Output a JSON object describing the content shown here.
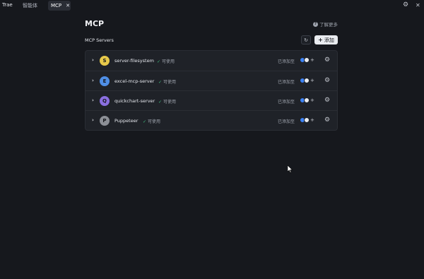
{
  "app": {
    "name": "Trae"
  },
  "tabs": [
    {
      "label": "智能体"
    },
    {
      "label": "MCP",
      "close": "✕"
    }
  ],
  "window": {
    "gear": "⚙",
    "close": "✕"
  },
  "header": {
    "title": "MCP",
    "learn_more": "了解更多",
    "learn_more_icon": "?"
  },
  "section": {
    "title": "MCP Servers",
    "refresh": "↻",
    "add_label": "添加",
    "add_plus": "+"
  },
  "servers": [
    {
      "initial": "S",
      "name": "server-filesystem",
      "status": "可使用",
      "added": "已添加至",
      "color": "#e6c84a"
    },
    {
      "initial": "E",
      "name": "excel-mcp-server",
      "status": "可使用",
      "added": "已添加至",
      "color": "#4f8fe6"
    },
    {
      "initial": "Q",
      "name": "quickchart-server",
      "status": "可使用",
      "added": "已添加至",
      "color": "#8a6fe0"
    },
    {
      "initial": "P",
      "name": "Puppeteer",
      "status": "可使用",
      "added": "已添加至",
      "color": "#8c8f96"
    }
  ],
  "icons": {
    "chevron": "›",
    "check": "✓",
    "row_plus": "+",
    "row_gear": "⚙"
  }
}
